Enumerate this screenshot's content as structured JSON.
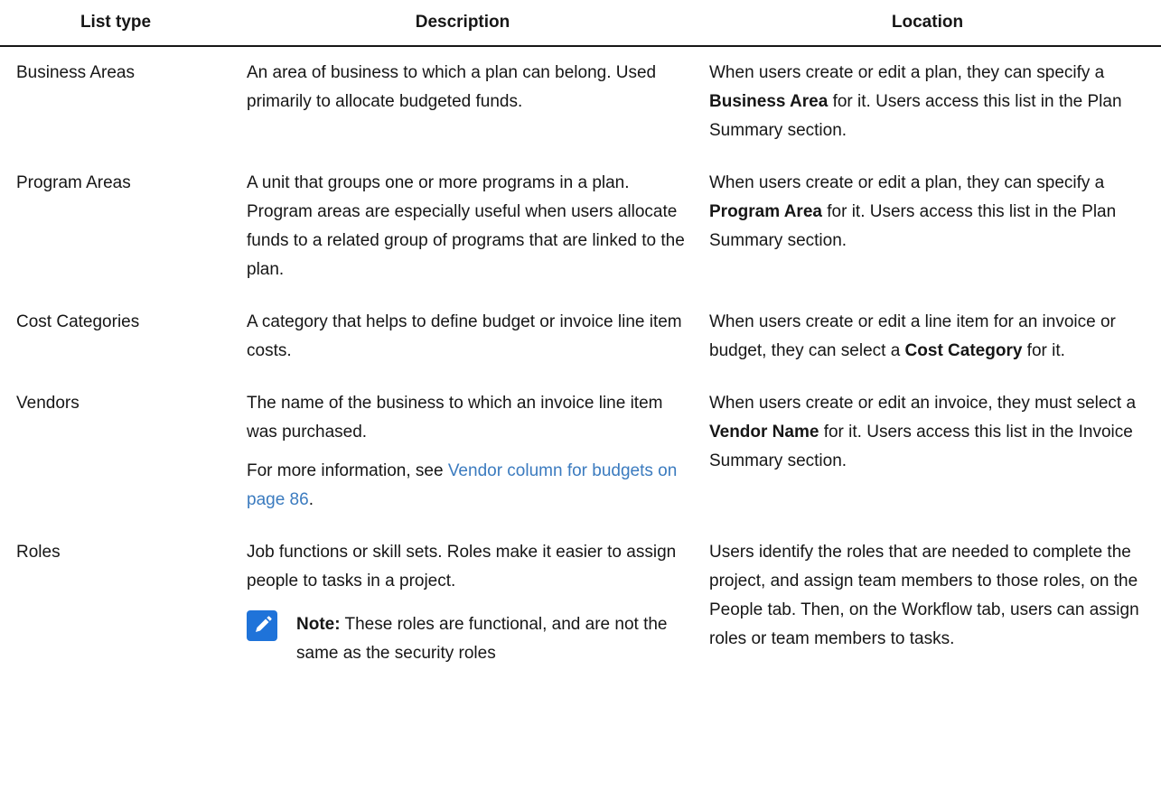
{
  "table": {
    "headers": [
      "List type",
      "Description",
      "Location"
    ],
    "rows": [
      {
        "type": "Business Areas",
        "description": [
          "An area of business to which a plan can belong. Used primarily to allocate budgeted funds."
        ],
        "location": {
          "pre": "When users create or edit a plan, they can specify a ",
          "bold": "Business Area",
          "post": " for it. Users access this list in the Plan Summary section."
        }
      },
      {
        "type": "Program Areas",
        "description": [
          "A unit that groups one or more programs in a plan. Program areas are especially useful when users allocate funds to a related group of programs that are linked to the plan."
        ],
        "location": {
          "pre": "When users create or edit a plan, they can specify a ",
          "bold": "Program Area",
          "post": " for it. Users access this list in the Plan Summary section."
        }
      },
      {
        "type": "Cost Categories",
        "description": [
          "A category that helps to define budget or invoice line item costs."
        ],
        "location": {
          "pre": "When users create or edit a line item for an invoice or budget, they can select a ",
          "bold": "Cost Category",
          "post": " for it."
        }
      },
      {
        "type": "Vendors",
        "description": [
          "The name of the business to which an invoice line item was purchased."
        ],
        "more_info": {
          "pre": "For more information, see ",
          "link": "Vendor column for budgets on page 86",
          "post": "."
        },
        "location": {
          "pre": "When users create or edit an invoice, they must select a ",
          "bold": "Vendor Name",
          "post": " for it. Users access this list in the Invoice Summary section."
        }
      },
      {
        "type": "Roles",
        "description": [
          "Job functions or skill sets. Roles make it easier to assign people to tasks in a project."
        ],
        "note": {
          "label": "Note:",
          "text": " These roles are functional, and are not the same as the security roles"
        },
        "location_plain": "Users identify the roles that are needed to complete the project, and assign team members to those roles, on the People tab. Then, on the Workflow tab, users can assign roles or team members to tasks."
      }
    ]
  },
  "colors": {
    "text": "#161616",
    "link": "#3b7bbf",
    "note_icon": "#1f73d9"
  }
}
